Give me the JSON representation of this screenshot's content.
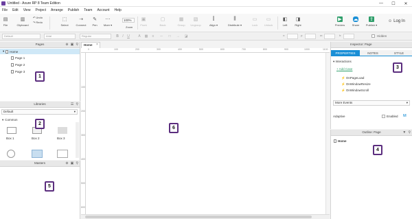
{
  "window": {
    "title": "Untitled - Axure RP 8 Team Edition",
    "controls": {
      "minimize": "—",
      "maximize": "☐",
      "close": "✕"
    }
  },
  "menu": [
    "File",
    "Edit",
    "View",
    "Project",
    "Arrange",
    "Publish",
    "Team",
    "Account",
    "Help"
  ],
  "toolbar": {
    "file": "File",
    "clipboard": "Clipboard",
    "undo": "Undo",
    "redo": "Redo",
    "select": "Select",
    "connect": "Connect",
    "pen": "Pen",
    "more": "More ▾",
    "zoom_value": "100%",
    "zoom_label": "Zoom",
    "front": "Front",
    "back": "Back",
    "group": "Group",
    "ungroup": "Ungroup",
    "align": "Align ▾",
    "distribute": "Distribute ▾",
    "lock": "Lock",
    "unlock": "Unlock",
    "left": "Left",
    "right": "Right",
    "preview": "Preview",
    "share": "Share",
    "publish": "Publish ▾",
    "login": "Log In"
  },
  "format_bar": {
    "style": "Default",
    "font": "Arial",
    "weight": "Regular",
    "x": "x:",
    "y": "y:",
    "w": "w:",
    "h": "h:",
    "hidden": "Hidden"
  },
  "pages_panel": {
    "title": "Pages",
    "home": "Home",
    "pages": [
      "Page 1",
      "Page 2",
      "Page 3"
    ]
  },
  "libraries_panel": {
    "title": "Libraries",
    "selected": "Default",
    "section": "Common",
    "items": [
      "Box 1",
      "Box 2",
      "Box 3"
    ]
  },
  "masters_panel": {
    "title": "Masters"
  },
  "canvas": {
    "tab": "Home",
    "ruler_h": [
      "0",
      "100",
      "200",
      "300",
      "400",
      "500",
      "600",
      "700",
      "800",
      "900",
      "1000",
      "1100"
    ],
    "ruler_v": [
      "100",
      "200",
      "300",
      "400",
      "500",
      "600"
    ]
  },
  "inspector": {
    "title": "Inspector: Page",
    "tabs": [
      "PROPERTIES",
      "NOTES",
      "STYLE"
    ],
    "interactions": "Interactions",
    "add_case": "Add Case",
    "events": [
      "OnPageLoad",
      "OnWindowResize",
      "OnWindowScroll"
    ],
    "more_events": "More Events",
    "adaptive": "Adaptive",
    "enabled": "Enabled"
  },
  "outline_panel": {
    "title": "Outline: Page",
    "home": "Home"
  },
  "badges": [
    "1",
    "2",
    "3",
    "4",
    "5",
    "6"
  ],
  "colors": {
    "accent": "#1a8fd6",
    "badge_border": "#5b2d7e",
    "app_icon": "#6b3fa0",
    "action_green": "#2e9e6a",
    "event_green": "#3a9a3a"
  }
}
